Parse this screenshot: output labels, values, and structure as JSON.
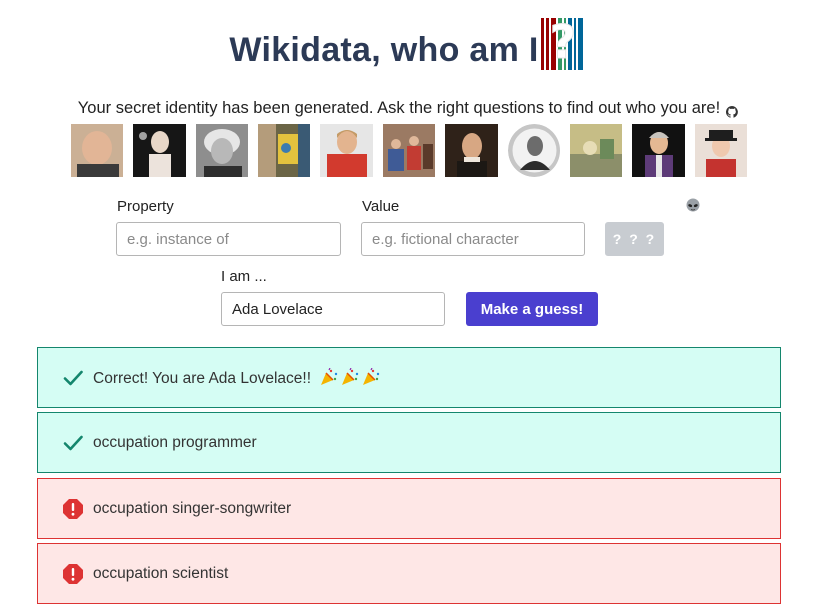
{
  "header": {
    "title": "Wikidata, who am I",
    "subtitle": "Your secret identity has been generated. Ask the right questions to find out who you are!"
  },
  "portraits": [
    {
      "name": "portrait-1",
      "icon": "photo-man-bald",
      "bg": "#d7c0a8"
    },
    {
      "name": "portrait-2",
      "icon": "photo-performer",
      "bg": "#1b1b1b"
    },
    {
      "name": "portrait-3",
      "icon": "photo-einstein",
      "bg": "#9a9a9a"
    },
    {
      "name": "portrait-4",
      "icon": "photo-street",
      "bg": "#5d5a3a"
    },
    {
      "name": "portrait-5",
      "icon": "photo-merkel",
      "bg": "#c64b3f"
    },
    {
      "name": "portrait-6",
      "icon": "photo-group",
      "bg": "#8b6b55"
    },
    {
      "name": "portrait-7",
      "icon": "photo-shakespeare",
      "bg": "#3a2a1e"
    },
    {
      "name": "portrait-8",
      "icon": "photo-engraving",
      "bg": "#b7b7b7"
    },
    {
      "name": "portrait-9",
      "icon": "photo-scene",
      "bg": "#b8b070"
    },
    {
      "name": "portrait-10",
      "icon": "photo-woman",
      "bg": "#3f2b4a"
    },
    {
      "name": "portrait-11",
      "icon": "photo-mary-poppins",
      "bg": "#e3d6cd"
    }
  ],
  "form": {
    "property_label": "Property",
    "property_placeholder": "e.g. instance of",
    "value_label": "Value",
    "value_placeholder": "e.g. fictional character",
    "ask_button": "? ? ?",
    "guess_label": "I am ...",
    "guess_value": "Ada Lovelace",
    "guess_button": "Make a guess!"
  },
  "messages": [
    {
      "type": "success",
      "icon": "check-icon",
      "text": "Correct! You are Ada Lovelace!!"
    },
    {
      "type": "success",
      "icon": "check-icon",
      "text": "occupation programmer"
    },
    {
      "type": "error",
      "icon": "error-icon",
      "text": "occupation singer-songwriter"
    },
    {
      "type": "error",
      "icon": "error-icon",
      "text": "occupation scientist"
    }
  ],
  "colors": {
    "title": "#2c3a56",
    "primary_button": "#4a3fcf",
    "disabled_button": "#c8ccd1",
    "success_bg": "#d5fdf4",
    "success_border": "#14866d",
    "error_bg": "#fee7e6",
    "error_border": "#dd3333"
  }
}
